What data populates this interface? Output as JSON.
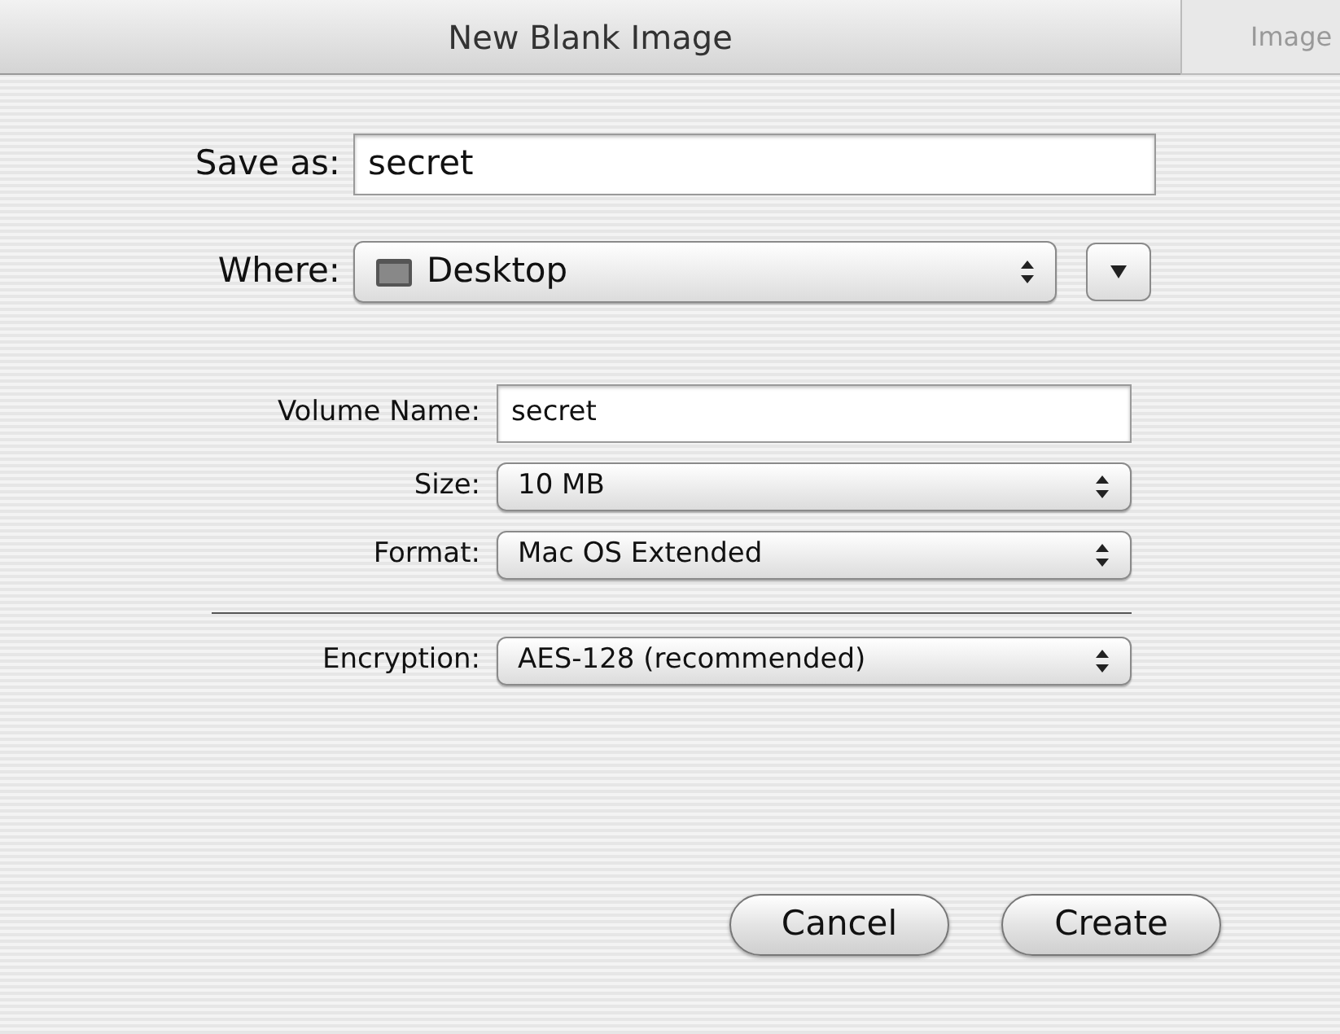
{
  "window": {
    "title": "New Blank Image"
  },
  "background_window": {
    "title": "Image"
  },
  "save_as": {
    "label": "Save as:",
    "value": "secret"
  },
  "where": {
    "label": "Where:",
    "value": "Desktop"
  },
  "fields": [
    {
      "kind": "text",
      "label": "Volume Name:",
      "value": "secret"
    },
    {
      "kind": "popup",
      "label": "Size:",
      "value": "10 MB"
    },
    {
      "kind": "popup",
      "label": "Format:",
      "value": "Mac OS Extended"
    }
  ],
  "encryption": {
    "label": "Encryption:",
    "value": "AES-128 (recommended)"
  },
  "buttons": [
    {
      "label": "Cancel"
    },
    {
      "label": "Create"
    }
  ]
}
